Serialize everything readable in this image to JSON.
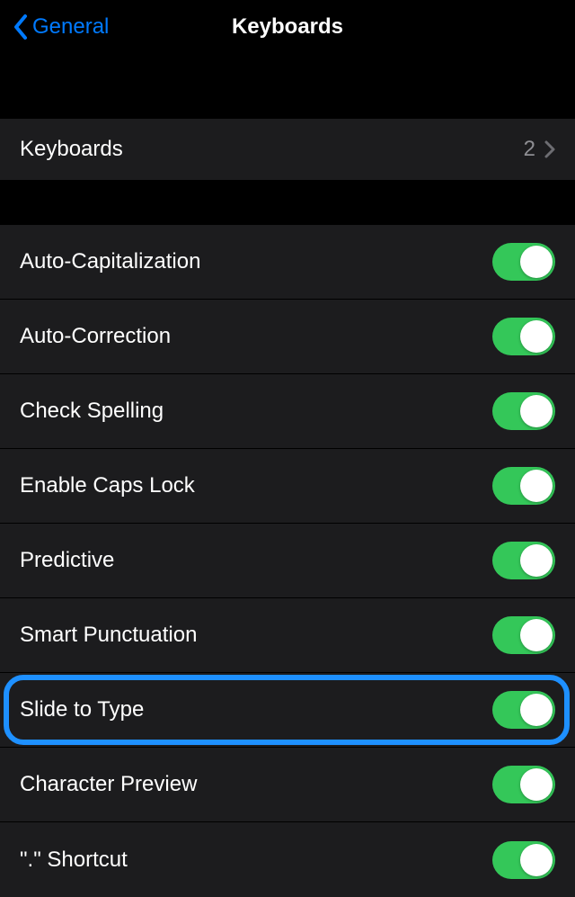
{
  "nav": {
    "back_label": "General",
    "title": "Keyboards"
  },
  "keyboards_link": {
    "label": "Keyboards",
    "count": "2"
  },
  "toggles": [
    {
      "label": "Auto-Capitalization",
      "on": true,
      "highlighted": false
    },
    {
      "label": "Auto-Correction",
      "on": true,
      "highlighted": false
    },
    {
      "label": "Check Spelling",
      "on": true,
      "highlighted": false
    },
    {
      "label": "Enable Caps Lock",
      "on": true,
      "highlighted": false
    },
    {
      "label": "Predictive",
      "on": true,
      "highlighted": false
    },
    {
      "label": "Smart Punctuation",
      "on": true,
      "highlighted": false
    },
    {
      "label": "Slide to Type",
      "on": true,
      "highlighted": true
    },
    {
      "label": "Character Preview",
      "on": true,
      "highlighted": false
    },
    {
      "label": "\".\" Shortcut",
      "on": true,
      "highlighted": false
    }
  ],
  "colors": {
    "accent_blue": "#007aff",
    "toggle_green": "#34c759",
    "highlight_blue": "#1e90ff"
  }
}
